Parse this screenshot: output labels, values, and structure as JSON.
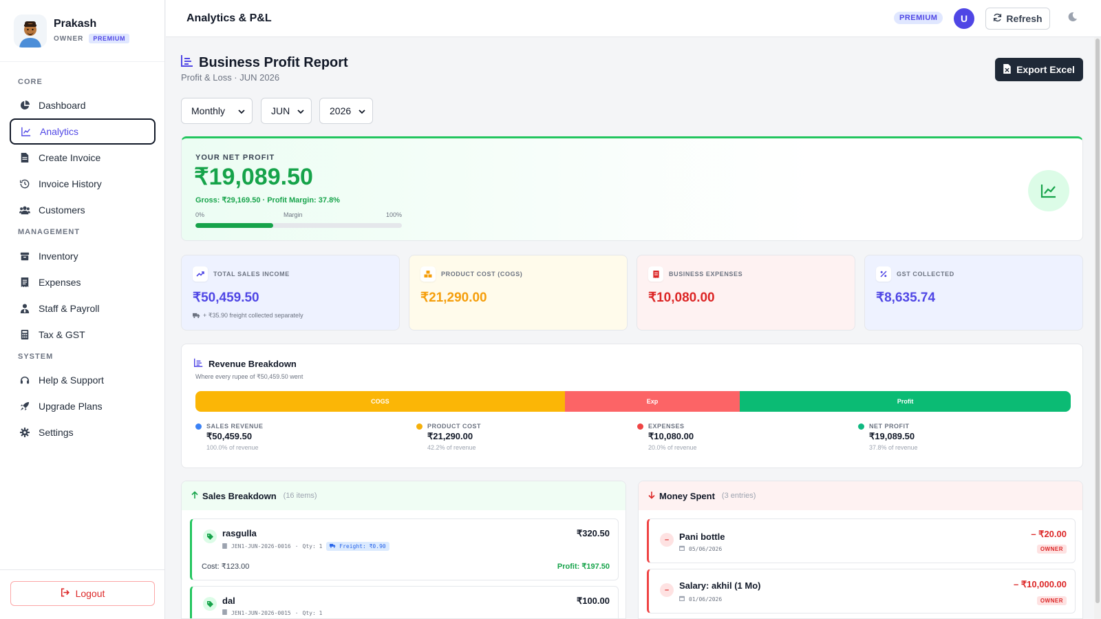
{
  "sidebar": {
    "profile": {
      "name": "Prakash",
      "role": "OWNER",
      "badge": "PREMIUM"
    },
    "sections": {
      "core": "CORE",
      "management": "MANAGEMENT",
      "system": "SYSTEM"
    },
    "items": {
      "dashboard": "Dashboard",
      "analytics": "Analytics",
      "create_invoice": "Create Invoice",
      "invoice_history": "Invoice History",
      "customers": "Customers",
      "inventory": "Inventory",
      "expenses": "Expenses",
      "staff_payroll": "Staff & Payroll",
      "tax_gst": "Tax & GST",
      "help_support": "Help & Support",
      "upgrade_plans": "Upgrade Plans",
      "settings": "Settings"
    },
    "active": "Analytics",
    "logout": "Logout"
  },
  "topbar": {
    "title": "Analytics & P&L",
    "premium": "PREMIUM",
    "user_initial": "U",
    "refresh": "Refresh"
  },
  "header": {
    "title": "Business Profit Report",
    "subtitle": "Profit & Loss · JUN 2026",
    "export": "Export Excel"
  },
  "filters": {
    "period": "Monthly",
    "month": "JUN",
    "year": "2026"
  },
  "net_profit": {
    "label": "YOUR NET PROFIT",
    "value": "₹19,089.50",
    "gross_line": "Gross: ₹29,169.50 · Profit Margin: 37.8%",
    "scale_min": "0%",
    "scale_mid": "Margin",
    "scale_max": "100%",
    "margin_percent": 37.8
  },
  "stats": {
    "sales": {
      "label": "TOTAL SALES INCOME",
      "value": "₹50,459.50",
      "note": "+ ₹35.90 freight collected separately"
    },
    "cogs": {
      "label": "PRODUCT COST (COGS)",
      "value": "₹21,290.00"
    },
    "expenses": {
      "label": "BUSINESS EXPENSES",
      "value": "₹10,080.00"
    },
    "gst": {
      "label": "GST COLLECTED",
      "value": "₹8,635.74"
    }
  },
  "revenue_breakdown": {
    "title": "Revenue Breakdown",
    "subtitle": "Where every rupee of ₹50,459.50 went",
    "segments": [
      {
        "label": "COGS",
        "percent": 42.2,
        "color": "#fbb606"
      },
      {
        "label": "Exp",
        "percent": 20.0,
        "color": "#fc6466"
      },
      {
        "label": "Profit",
        "percent": 37.8,
        "color": "#0bbb74"
      }
    ],
    "legend": {
      "sales": {
        "label": "SALES REVENUE",
        "value": "₹50,459.50",
        "pct": "100.0% of revenue",
        "color": "#3b82f6"
      },
      "cost": {
        "label": "PRODUCT COST",
        "value": "₹21,290.00",
        "pct": "42.2% of revenue",
        "color": "#f5b00b"
      },
      "expenses": {
        "label": "EXPENSES",
        "value": "₹10,080.00",
        "pct": "20.0% of revenue",
        "color": "#ef4444"
      },
      "profit": {
        "label": "NET PROFIT",
        "value": "₹19,089.50",
        "pct": "37.8% of revenue",
        "color": "#10b981"
      }
    }
  },
  "sales_breakdown": {
    "title": "Sales Breakdown",
    "count": "(16 items)",
    "items": [
      {
        "name": "rasgulla",
        "invoice": "JEN1-JUN-2026-0016",
        "qty": "Qty: 1",
        "freight": "Freight: ₹0.90",
        "amount": "₹320.50",
        "cost": "Cost: ₹123.00",
        "profit": "Profit: ₹197.50"
      },
      {
        "name": "dal",
        "invoice": "JEN1-JUN-2026-0015",
        "qty": "Qty: 1",
        "amount": "₹100.00"
      }
    ]
  },
  "money_spent": {
    "title": "Money Spent",
    "count": "(3 entries)",
    "items": [
      {
        "name": "Pani bottle",
        "date": "05/06/2026",
        "amount": "– ₹20.00",
        "tag": "OWNER"
      },
      {
        "name": "Salary: akhil (1 Mo)",
        "date": "01/06/2026",
        "amount": "– ₹10,000.00",
        "tag": "OWNER"
      }
    ]
  }
}
